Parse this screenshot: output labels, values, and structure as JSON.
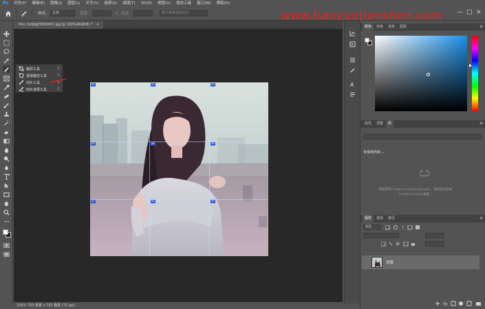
{
  "app": {
    "logo_text": "Ps",
    "menu": [
      "文件(F)",
      "编辑(E)",
      "图像(I)",
      "图层(L)",
      "文字(Y)",
      "选择(S)",
      "滤镜(T)",
      "3D(D)",
      "视图(V)",
      "增效工具",
      "窗口(W)",
      "帮助(H)"
    ]
  },
  "options_bar": {
    "style_label": "样式:",
    "style_value": "正常",
    "width_label": "宽度:",
    "height_label": "高度:",
    "guides_button": "基于参考线的切片",
    "watermark": "www.baoyuejianshen.com"
  },
  "window_controls": {
    "minimize": "—",
    "maximize": "□",
    "close": "×"
  },
  "document": {
    "tab_title": "74cc 5c6dgf3093457.jpg @ 100%(RGB/8) *",
    "tab_close": "×",
    "status": "100%      703 像素 x 792 像素 (72 ppi)"
  },
  "slices": [
    "01",
    "02",
    "03",
    "04",
    "05",
    "06",
    "07",
    "08",
    "09"
  ],
  "flyout": {
    "items": [
      {
        "label": "裁剪工具",
        "key": "C",
        "icon": "crop-icon"
      },
      {
        "label": "透视裁剪工具",
        "key": "C",
        "icon": "perspective-crop-icon"
      },
      {
        "label": "切片工具",
        "key": "C",
        "icon": "slice-icon"
      },
      {
        "label": "切片选择工具",
        "key": "C",
        "icon": "slice-select-icon"
      }
    ]
  },
  "panels": {
    "color_tabs": [
      "颜色",
      "色板",
      "渐变",
      "图案"
    ],
    "libraries_tabs": [
      "属性",
      "调整",
      "库"
    ],
    "libraries_dropdown": "未保存的库",
    "libraries_message": "若要使用 Creative Cloud Libraries，请安装并登录 Creative Cloud 桌面。",
    "layers_tabs": [
      "图层",
      "通道",
      "路径"
    ],
    "layer_filter": "类型",
    "layer_name": "背景"
  },
  "colors": {
    "accent": "#31a8ff",
    "watermark": "#ee2020",
    "slice_tag": "#2a5bd7"
  }
}
